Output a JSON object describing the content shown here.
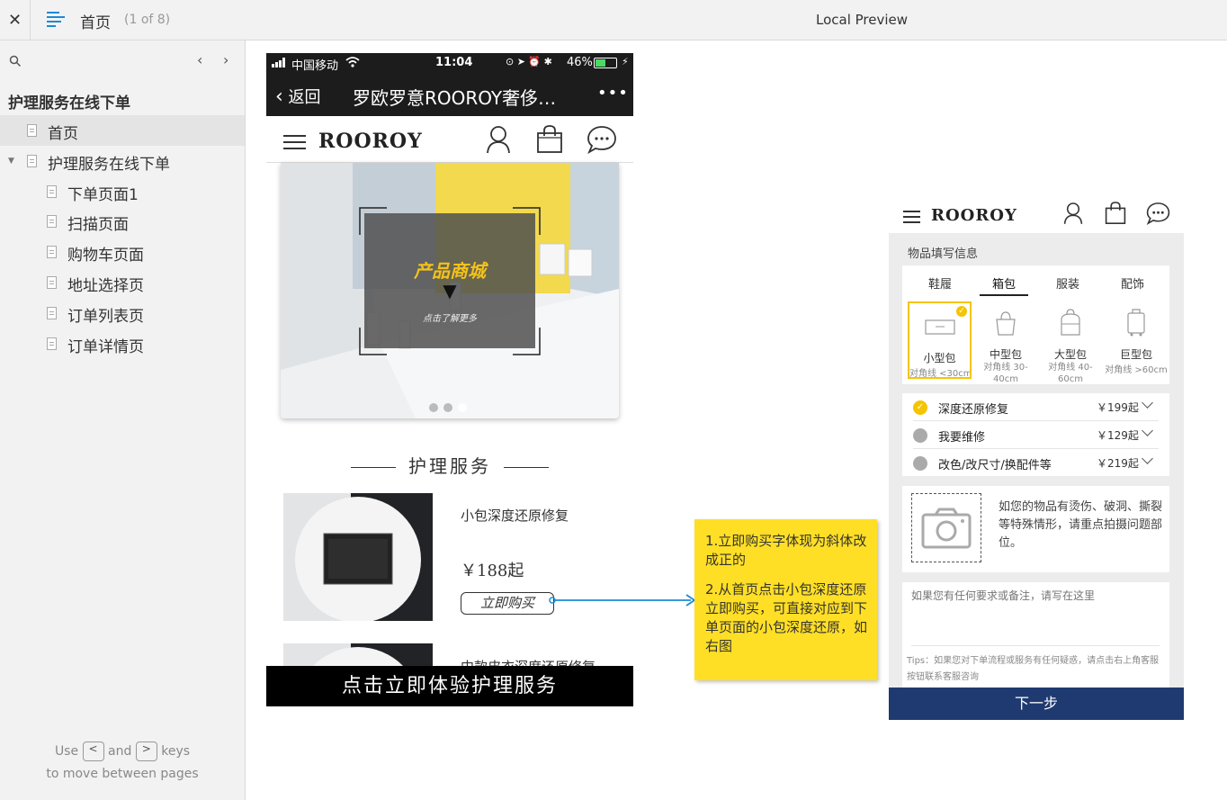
{
  "topbar": {
    "title": "首页",
    "page_count": "(1 of 8)",
    "preview_label": "Local Preview"
  },
  "sidebar": {
    "project_title": "护理服务在线下单",
    "items": [
      {
        "label": "首页"
      },
      {
        "label": "护理服务在线下单"
      },
      {
        "label": "下单页面1"
      },
      {
        "label": "扫描页面"
      },
      {
        "label": "购物车页面"
      },
      {
        "label": "地址选择页"
      },
      {
        "label": "订单列表页"
      },
      {
        "label": "订单详情页"
      }
    ],
    "hint_use": "Use",
    "hint_and": "and",
    "hint_keys": "keys",
    "hint_line2": "to move between pages",
    "key_prev": "<",
    "key_next": ">"
  },
  "phone1": {
    "status": {
      "carrier": "中国移动",
      "time": "11:04",
      "battery": "46%"
    },
    "wx": {
      "back": "返回",
      "title": "罗欧罗意ROOROY奢侈…",
      "more": "•••"
    },
    "logo": "ROOROY",
    "banner": {
      "headline": "产品商城",
      "subline": "点击了解更多"
    },
    "section_title": "护理服务",
    "product1": {
      "name": "小包深度还原修复",
      "price": "￥188起",
      "buy": "立即购买"
    },
    "product2": {
      "name": "中款皮衣深度还原修复"
    },
    "cta": "点击立即体验护理服务"
  },
  "note": {
    "p1": "1.立即购买字体现为斜体改成正的",
    "p2": "2.从首页点击小包深度还原立即购买，可直接对应到下单页面的小包深度还原，如右图"
  },
  "phone2": {
    "logo": "ROOROY",
    "section_label": "物品填写信息",
    "tabs": [
      "鞋履",
      "箱包",
      "服装",
      "配饰"
    ],
    "active_tab": "箱包",
    "bags": [
      {
        "name": "小型包",
        "size": "对角线 <30cm"
      },
      {
        "name": "中型包",
        "size": "对角线 30-40cm"
      },
      {
        "name": "大型包",
        "size": "对角线 40-60cm"
      },
      {
        "name": "巨型包",
        "size": "对角线 >60cm"
      }
    ],
    "services": [
      {
        "name": "深度还原修复",
        "price": "￥199起"
      },
      {
        "name": "我要维修",
        "price": "￥129起"
      },
      {
        "name": "改色/改尺寸/换配件等",
        "price": "￥219起"
      }
    ],
    "photo_hint": "如您的物品有烫伤、破洞、撕裂等特殊情形，请重点拍摄问题部位。",
    "remarks_placeholder": "如果您有任何要求或备注，请写在这里",
    "tips": "Tips：如果您对下单流程或服务有任何疑惑，请点击右上角客服按钮联系客服咨询",
    "next_button": "下一步",
    "accent": "#f5c400",
    "button_color": "#1f3a70"
  }
}
